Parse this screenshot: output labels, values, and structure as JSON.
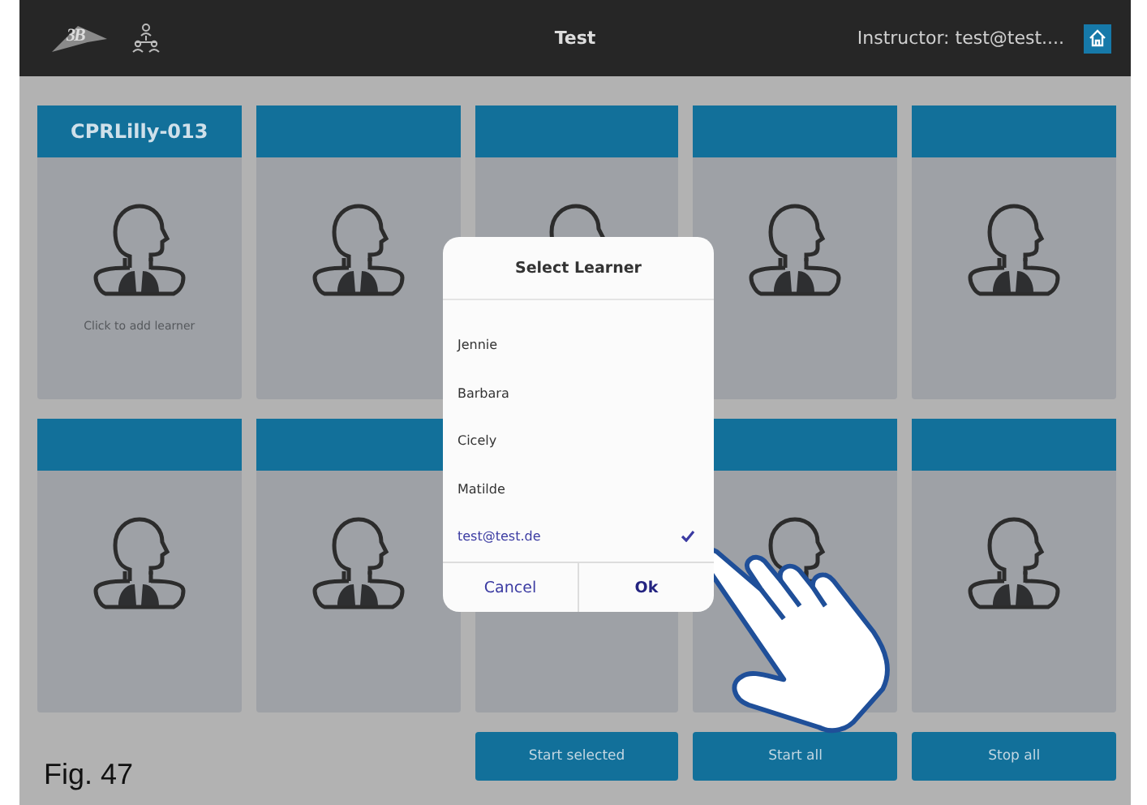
{
  "top_bar": {
    "logo_text": "3B",
    "title": "Test",
    "instructor": "Instructor: test@test...."
  },
  "stations": [
    {
      "kind": "assigned",
      "title": "CPRLilly-013",
      "hint": "Click to add learner"
    },
    {
      "kind": "empty"
    },
    {
      "kind": "empty"
    },
    {
      "kind": "empty"
    },
    {
      "kind": "empty"
    },
    {
      "kind": "empty"
    },
    {
      "kind": "empty"
    },
    {
      "kind": "empty"
    },
    {
      "kind": "empty"
    },
    {
      "kind": "empty"
    }
  ],
  "buttons": [
    "Start selected",
    "Start all",
    "Stop all"
  ],
  "dialog": {
    "title": "Select Learner",
    "learners": [
      {
        "name": "Jennie",
        "selected": false
      },
      {
        "name": "Barbara",
        "selected": false
      },
      {
        "name": "Cicely",
        "selected": false
      },
      {
        "name": "Matilde",
        "selected": false
      },
      {
        "name": "test@test.de",
        "selected": true
      }
    ],
    "cancel": "Cancel",
    "ok": "Ok"
  },
  "caption": "Fig. 47"
}
